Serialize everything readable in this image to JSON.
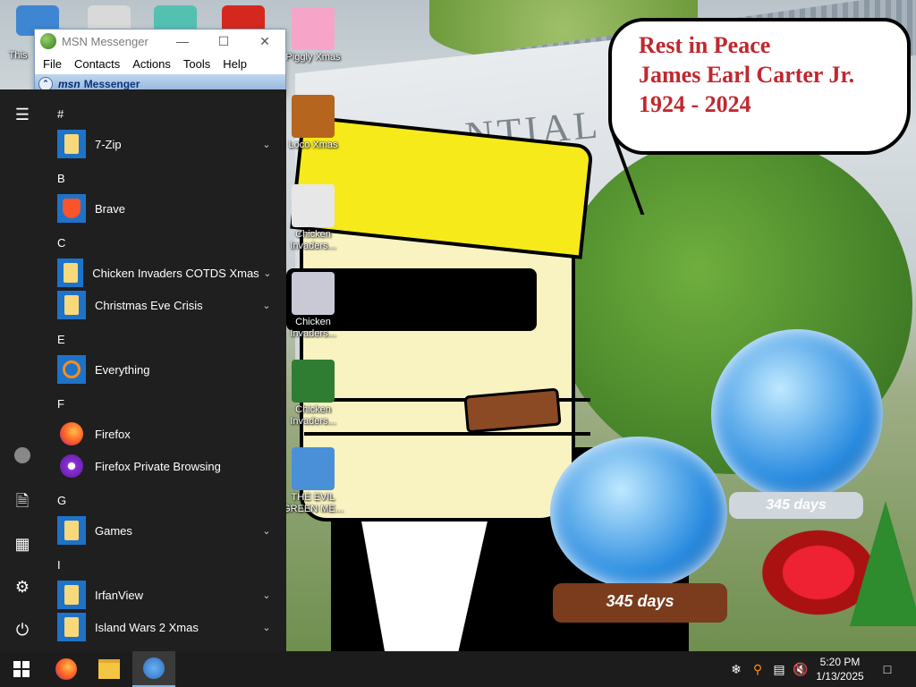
{
  "desktop": {
    "speech_bubble": {
      "line1": "Rest in Peace",
      "line2": "James Earl Carter Jr.",
      "line3": "1924 - 2024"
    },
    "building_text": "NTIAL",
    "snowglobe_small": "345 days",
    "snowglobe_large": "345 days",
    "icons": [
      {
        "label": "This",
        "icon": "this-pc-icon"
      },
      {
        "label": "Piggly Xmas",
        "icon": "piggly-xmas-icon"
      },
      {
        "label": "Loco Xmas",
        "icon": "loco-xmas-icon"
      },
      {
        "label": "Chicken Invaders...",
        "icon": "chicken-invaders-icon"
      },
      {
        "label": "Chicken Invaders...",
        "icon": "chicken-invaders-icon"
      },
      {
        "label": "Chicken Invaders...",
        "icon": "chicken-invaders-icon"
      },
      {
        "label": "THE EVIL GREEN ME...",
        "icon": "messenger-people-icon"
      }
    ]
  },
  "msn_window": {
    "title": "MSN Messenger",
    "menu": [
      "File",
      "Contacts",
      "Actions",
      "Tools",
      "Help"
    ],
    "banner_logo": "msn",
    "banner_text": "Messenger"
  },
  "start_menu": {
    "sections": [
      {
        "letter": "#",
        "apps": [
          {
            "label": "7-Zip",
            "icon": "folder-icon",
            "expandable": true
          }
        ]
      },
      {
        "letter": "B",
        "apps": [
          {
            "label": "Brave",
            "icon": "brave-icon",
            "expandable": false
          }
        ]
      },
      {
        "letter": "C",
        "apps": [
          {
            "label": "Chicken Invaders COTDS Xmas",
            "icon": "folder-icon",
            "expandable": true
          },
          {
            "label": "Christmas Eve Crisis",
            "icon": "folder-icon",
            "expandable": true
          }
        ]
      },
      {
        "letter": "E",
        "apps": [
          {
            "label": "Everything",
            "icon": "everything-search-icon",
            "expandable": false
          }
        ]
      },
      {
        "letter": "F",
        "apps": [
          {
            "label": "Firefox",
            "icon": "firefox-icon",
            "expandable": false
          },
          {
            "label": "Firefox Private Browsing",
            "icon": "firefox-private-icon",
            "expandable": false
          }
        ]
      },
      {
        "letter": "G",
        "apps": [
          {
            "label": "Games",
            "icon": "folder-icon",
            "expandable": true
          }
        ]
      },
      {
        "letter": "I",
        "apps": [
          {
            "label": "IrfanView",
            "icon": "folder-icon",
            "expandable": true
          },
          {
            "label": "Island Wars 2 Xmas",
            "icon": "folder-icon",
            "expandable": true
          }
        ]
      }
    ]
  },
  "taskbar": {
    "clock_time": "5:20 PM",
    "clock_date": "1/13/2025"
  },
  "colors": {
    "start_bg": "#1f1f1f",
    "taskbar_bg": "#1c1c1c",
    "folder_blue": "#1e73c8",
    "bubble_text": "#c0282f"
  }
}
